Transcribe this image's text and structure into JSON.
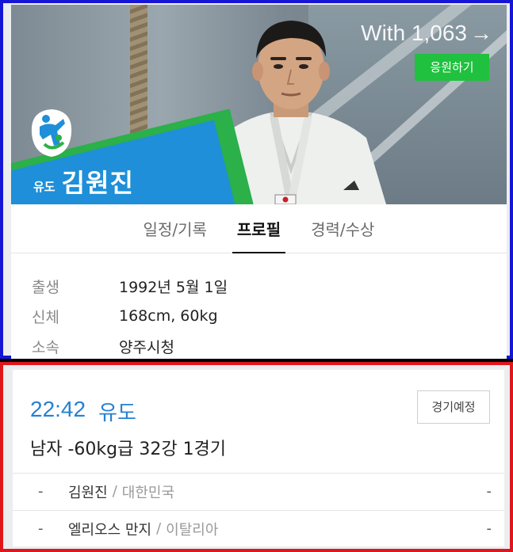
{
  "header": {
    "with_text": "With 1,063",
    "with_arrow": "→",
    "cheer_button": "응원하기"
  },
  "athlete": {
    "sport": "유도",
    "name": "김원진"
  },
  "tabs": [
    {
      "label": "일정/기록",
      "active": false
    },
    {
      "label": "프로필",
      "active": true
    },
    {
      "label": "경력/수상",
      "active": false
    }
  ],
  "profile": [
    {
      "label": "출생",
      "value": "1992년 5월 1일"
    },
    {
      "label": "신체",
      "value": "168cm, 60kg"
    },
    {
      "label": "소속",
      "value": "양주시청"
    }
  ],
  "match": {
    "time": "22:42",
    "sport": "유도",
    "status_button": "경기예정",
    "title": "남자 -60kg급 32강 1경기",
    "competitors": [
      {
        "left": "-",
        "name": "김원진",
        "separator": "/",
        "country": "대한민국",
        "right": "-"
      },
      {
        "left": "-",
        "name": "엘리오스 만지",
        "separator": "/",
        "country": "이탈리아",
        "right": "-"
      }
    ]
  },
  "colors": {
    "top_frame": "#1515d6",
    "bottom_frame": "#e0161d",
    "accent_blue": "#2581d2",
    "cheer_green": "#1fc13e",
    "band_green": "#2bb04a",
    "band_blue": "#1e8fd8"
  }
}
